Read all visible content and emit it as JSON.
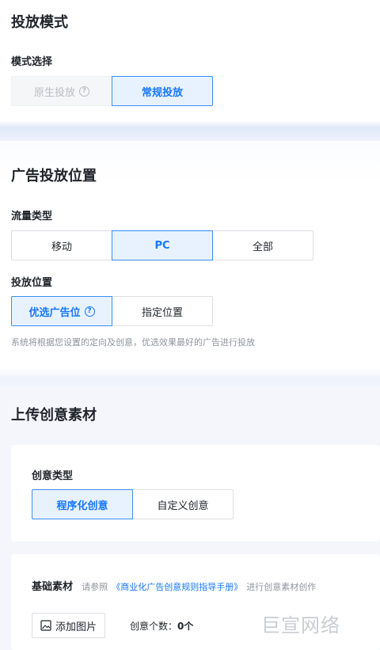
{
  "section1": {
    "title": "投放模式",
    "mode_label": "模式选择",
    "options": [
      {
        "label": "原生投放",
        "state": "disabled"
      },
      {
        "label": "常规投放",
        "state": "active"
      }
    ]
  },
  "section2": {
    "title": "广告投放位置",
    "traffic_label": "流量类型",
    "traffic_options": [
      "移动",
      "PC",
      "全部"
    ],
    "placement_label": "投放位置",
    "placement_options": [
      "优选广告位",
      "指定位置"
    ],
    "hint": "系统将根据您设置的定向及创意，优选效果最好的广告进行投放"
  },
  "section3": {
    "title": "上传创意素材",
    "creative_type_label": "创意类型",
    "creative_options": [
      "程序化创意",
      "自定义创意"
    ],
    "basic_label": "基础素材",
    "basic_desc_prefix": "请参照",
    "basic_desc_link": "《商业化广告创意规则指导手册》",
    "basic_desc_suffix": "进行创意素材创作",
    "add_image": "添加图片",
    "count_label": "创意个数：",
    "count_value": "0个"
  },
  "watermark": "巨宣网络",
  "colors": {
    "accent": "#1677ff",
    "accent_bg": "#e8f2ff",
    "band": "#eef2fb"
  }
}
